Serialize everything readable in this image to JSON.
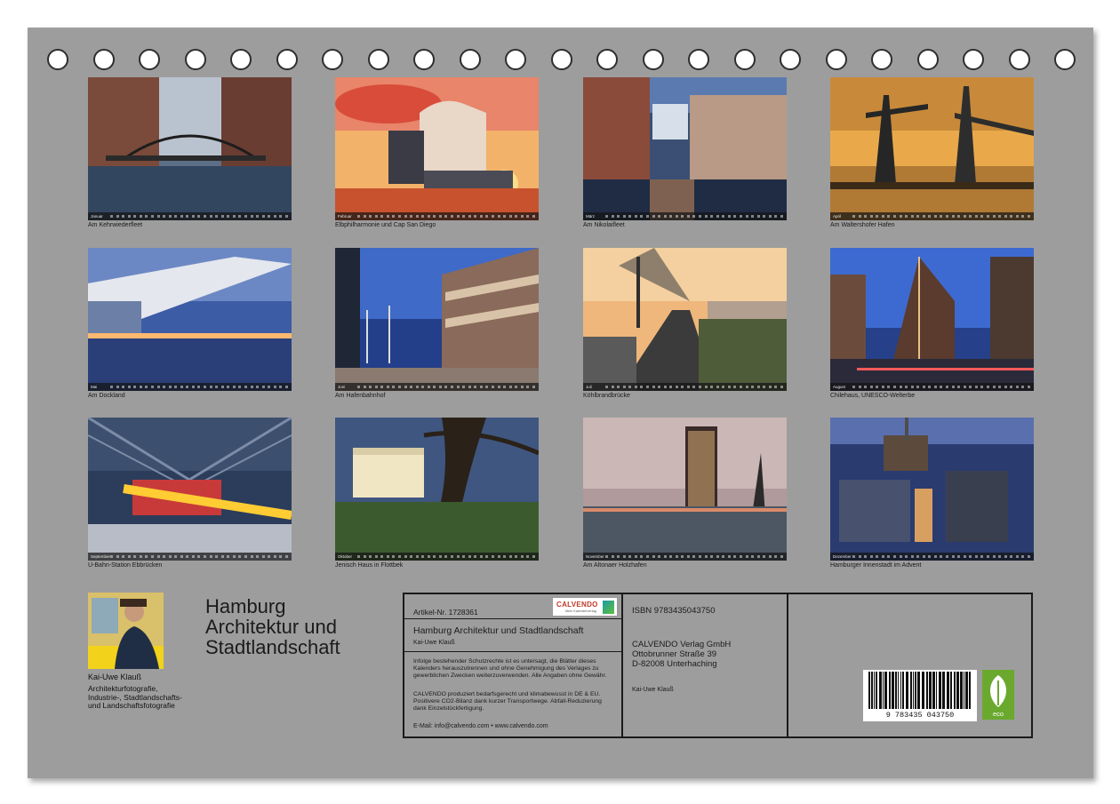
{
  "tiles": [
    {
      "caption": "Am Kehrwiederfleet",
      "month": "Januar"
    },
    {
      "caption": "Elbphilharmonie und Cap San Diego",
      "month": "Februar"
    },
    {
      "caption": "Am Nikolaifleet",
      "month": "März"
    },
    {
      "caption": "Am Waltershofer Hafen",
      "month": "April"
    },
    {
      "caption": "Am Dockland",
      "month": "Mai"
    },
    {
      "caption": "Am Hafenbahnhof",
      "month": "Juni"
    },
    {
      "caption": "Köhlbrandbrücke",
      "month": "Juli"
    },
    {
      "caption": "Chilehaus, UNESCO-Welterbe",
      "month": "August"
    },
    {
      "caption": "U-Bahn-Station Ebbrücken",
      "month": "September"
    },
    {
      "caption": "Jenisch Haus in Flottbek",
      "month": "Oktober"
    },
    {
      "caption": "Am Altonaer Holzhafen",
      "month": "November"
    },
    {
      "caption": "Hamburger Innenstadt im Advent",
      "month": "Dezember"
    }
  ],
  "author": {
    "name": "Kai-Uwe Klauß",
    "description": "Architekturfotografie, Industrie-, Stadtlandschafts- und Landschaftsfotografie"
  },
  "title_lines": [
    "Hamburg",
    "Architektur und",
    "Stadtlandschaft"
  ],
  "info": {
    "artikel": "Artikel-Nr. 1728361",
    "calvendo_logo": "CALVENDO",
    "calvendo_sub": "Mein Kalenderverlag",
    "title": "Hamburg Architektur und Stadtlandschaft",
    "author": "Kai-Uwe Klauß",
    "para1": "Infolge bestehender Schutzrechte ist es untersagt, die Blätter dieses Kalenders herauszutrennen und ohne Genehmigung des Verlages zu gewerblichen Zwecken weiterzuverwenden. Alle Angaben ohne Gewähr.",
    "para2": "CALVENDO produziert bedarfsgerecht und klimabewusst in DE & EU. Positivere CO2-Bilanz dank kurzer Transportwege. Abfall-Reduzierung dank Einzelstückfertigung.",
    "contact": "E-Mail: info@calvendo.com • www.calvendo.com",
    "isbn": "ISBN 9783435043750",
    "publisher": [
      "CALVENDO Verlag GmbH",
      "Ottobrunner Straße 39",
      "D-82008 Unterhaching"
    ],
    "author2": "Kai-Uwe Klauß",
    "barcode_digits": "9 783435 043750",
    "eco_label": "eco"
  }
}
